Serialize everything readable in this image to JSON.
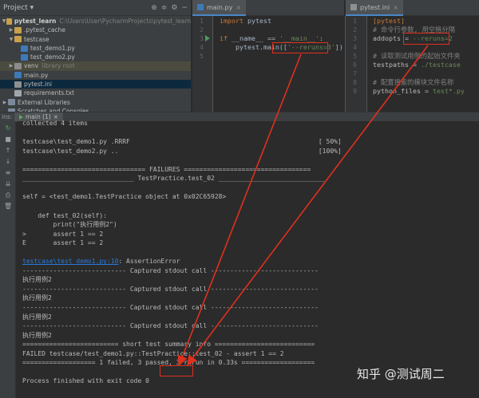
{
  "project": {
    "header_label": "Project",
    "tree": [
      {
        "depth": 0,
        "arrow": "▼",
        "icon": "folder",
        "name": "pytest_learn",
        "hint": "C:\\Users\\User\\PycharmProjects\\pytest_learn",
        "bold": true
      },
      {
        "depth": 1,
        "arrow": "▶",
        "icon": "folder",
        "name": ".pytest_cache",
        "hint": ""
      },
      {
        "depth": 1,
        "arrow": "▼",
        "icon": "folder",
        "name": "testcase",
        "hint": ""
      },
      {
        "depth": 2,
        "arrow": "",
        "icon": "py",
        "name": "test_demo1.py",
        "hint": ""
      },
      {
        "depth": 2,
        "arrow": "",
        "icon": "py",
        "name": "test_demo2.py",
        "hint": ""
      },
      {
        "depth": 1,
        "arrow": "▶",
        "icon": "folder-gray",
        "name": "venv",
        "hint": "library root",
        "highlight": true
      },
      {
        "depth": 1,
        "arrow": "",
        "icon": "py",
        "name": "main.py",
        "hint": ""
      },
      {
        "depth": 1,
        "arrow": "",
        "icon": "ini",
        "name": "pytest.ini",
        "hint": "",
        "selected": true
      },
      {
        "depth": 1,
        "arrow": "",
        "icon": "txt",
        "name": "requirements.txt",
        "hint": ""
      },
      {
        "depth": 0,
        "arrow": "▶",
        "icon": "lib",
        "name": "External Libraries",
        "hint": ""
      },
      {
        "depth": 0,
        "arrow": "",
        "icon": "lib",
        "name": "Scratches and Consoles",
        "hint": ""
      }
    ]
  },
  "editor_main": {
    "tab_label": "main.py",
    "line_numbers": [
      "1",
      "2",
      "3",
      "4",
      "5"
    ],
    "lines": [
      [
        {
          "c": "kw",
          "t": "import"
        },
        {
          "c": "",
          "t": " pytest"
        }
      ],
      [],
      [
        {
          "c": "kw",
          "t": "if"
        },
        {
          "c": "",
          "t": " __name__ == "
        },
        {
          "c": "str",
          "t": "'__main__'"
        },
        {
          "c": "",
          "t": ":"
        }
      ],
      [
        {
          "c": "",
          "t": "    pytest.main(["
        },
        {
          "c": "str",
          "t": "'--reruns=3'"
        },
        {
          "c": "",
          "t": "])"
        }
      ],
      []
    ]
  },
  "editor_ini": {
    "tab_label": "pytest.ini",
    "line_numbers": [
      "1",
      "2",
      "3",
      "4",
      "5",
      "6",
      "7",
      "8",
      "9"
    ],
    "lines": [
      [
        {
          "c": "sec",
          "t": "[pytest]"
        }
      ],
      [
        {
          "c": "cm",
          "t": "# 命令行参数, 用空格分隔"
        }
      ],
      [
        {
          "c": "key",
          "t": "addopts"
        },
        {
          "c": "",
          "t": " = "
        },
        {
          "c": "val",
          "t": "--reruns=2"
        }
      ],
      [],
      [
        {
          "c": "cm",
          "t": "# 读取测试用例的起始文件夹"
        }
      ],
      [
        {
          "c": "key",
          "t": "testpaths"
        },
        {
          "c": "",
          "t": " = "
        },
        {
          "c": "val",
          "t": "./testcase"
        }
      ],
      [],
      [
        {
          "c": "cm",
          "t": "# 配置搜索的模块文件名称"
        }
      ],
      [
        {
          "c": "key",
          "t": "python_files"
        },
        {
          "c": "",
          "t": " = "
        },
        {
          "c": "val",
          "t": "test*.py"
        }
      ]
    ]
  },
  "run_panel": {
    "side_label": "ins:",
    "tab_label": "main (1)",
    "tab_close": "×",
    "console_lines": [
      {
        "t": "collected 4 items"
      },
      {
        "t": ""
      },
      {
        "t": "testcase\\test_demo1.py .RRRF                                                 [ 50%]"
      },
      {
        "t": "testcase\\test_demo2.py ..                                                    [100%]"
      },
      {
        "t": ""
      },
      {
        "t": "================================ FAILURES ================================="
      },
      {
        "t": "_____________________________ TestPractice.test_02 ____________________________"
      },
      {
        "t": ""
      },
      {
        "t": "self = <test_demo1.TestPractice object at 0x02C65928>"
      },
      {
        "t": ""
      },
      {
        "t": "    def test_02(self):"
      },
      {
        "t": "        print(\"执行用例2\")"
      },
      {
        "t": ">       assert 1 == 2"
      },
      {
        "t": "E       assert 1 == 2"
      },
      {
        "t": ""
      },
      {
        "link": "testcase\\test_demo1.py:10",
        "t": ": AssertionError"
      },
      {
        "t": "--------------------------- Captured stdout call ----------------------------"
      },
      {
        "t": "执行用例2"
      },
      {
        "t": "--------------------------- Captured stdout call ----------------------------"
      },
      {
        "t": "执行用例2"
      },
      {
        "t": "--------------------------- Captured stdout call ----------------------------"
      },
      {
        "t": "执行用例2"
      },
      {
        "t": "--------------------------- Captured stdout call ----------------------------"
      },
      {
        "t": "执行用例2"
      },
      {
        "t": "========================= short test summary info =========================="
      },
      {
        "t": "FAILED testcase/test_demo1.py::TestPractice::test_02 - assert 1 == 2"
      },
      {
        "t": "=================== 1 failed, 3 passed, 3 rerun in 0.33s ==================="
      },
      {
        "t": ""
      },
      {
        "t": "Process finished with exit code 0"
      }
    ]
  },
  "watermark": "知乎 @测试周二",
  "colors": {
    "annotation_red": "#e0301e",
    "link_blue": "#287bde"
  }
}
